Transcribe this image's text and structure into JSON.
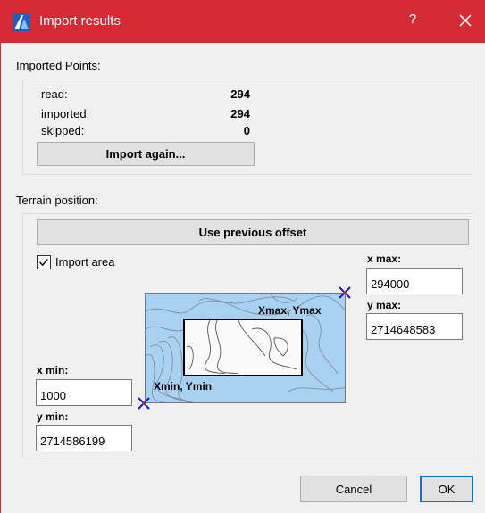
{
  "window": {
    "title": "Import results",
    "help_glyph": "?",
    "icons": {
      "app": "app-logo-icon",
      "close": "close-icon"
    }
  },
  "imported_points": {
    "heading": "Imported Points:",
    "stats": [
      {
        "label": "read:",
        "value": "294"
      },
      {
        "label": "imported:",
        "value": "294"
      },
      {
        "label": "skipped:",
        "value": "0"
      }
    ],
    "import_again_label": "Import again..."
  },
  "terrain_position": {
    "heading": "Terrain position:",
    "use_previous_offset_label": "Use previous offset",
    "import_area": {
      "label": "Import area",
      "checked": true
    },
    "x_max": {
      "label": "x max:",
      "value": "294000"
    },
    "y_max": {
      "label": "y max:",
      "value": "2714648583"
    },
    "x_min": {
      "label": "x min:",
      "value": "1000"
    },
    "y_min": {
      "label": "y min:",
      "value": "2714586199"
    },
    "map": {
      "max_corner_label": "Xmax, Ymax",
      "min_corner_label": "Xmin, Ymin",
      "marker_icon": "cross-marker-icon"
    }
  },
  "footer": {
    "cancel_label": "Cancel",
    "ok_label": "OK"
  },
  "colors": {
    "titlebar": "#d62b35",
    "map_water": "#a9d2f2",
    "marker_blue": "#1515cc",
    "marker_red": "#e01b1b"
  }
}
